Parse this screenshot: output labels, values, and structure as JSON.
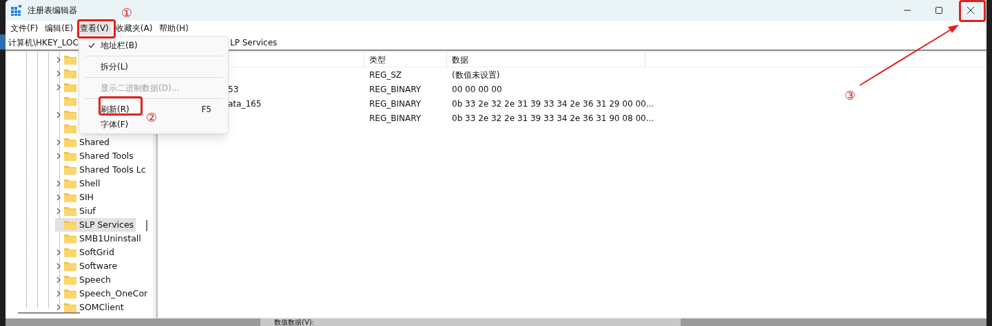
{
  "window": {
    "title": "注册表编辑器"
  },
  "window_controls": [
    {
      "kind": "minimize"
    },
    {
      "kind": "maximize"
    },
    {
      "kind": "close"
    }
  ],
  "menu_bar": [
    {
      "label": "文件(F)",
      "selected": false
    },
    {
      "label": "编辑(E)",
      "selected": false
    },
    {
      "label": "查看(V)",
      "selected": true
    },
    {
      "label": "收藏夹(A)",
      "selected": false
    },
    {
      "label": "帮助(H)",
      "selected": false
    }
  ],
  "address_bar": {
    "left": "计算机\\HKEY_LOC",
    "right": "LP Services"
  },
  "view_menu": {
    "items": [
      {
        "kind": "item",
        "label": "地址栏(B)",
        "checked": true,
        "disabled": false
      },
      {
        "kind": "separator"
      },
      {
        "kind": "item",
        "label": "拆分(L)",
        "checked": false,
        "disabled": false
      },
      {
        "kind": "separator"
      },
      {
        "kind": "item",
        "label": "显示二进制数据(D)...",
        "checked": false,
        "disabled": true
      },
      {
        "kind": "separator"
      },
      {
        "kind": "item",
        "label": "刷新(R)",
        "shortcut": "F5",
        "checked": false,
        "disabled": false
      },
      {
        "kind": "item",
        "label": "字体(F)",
        "checked": false,
        "disabled": false
      }
    ]
  },
  "tree": {
    "items": [
      {
        "expandable": true,
        "selected": false
      },
      {
        "expandable": true,
        "selected": false
      },
      {
        "expandable": true,
        "selected": false
      },
      {
        "expandable": false,
        "selected": false
      },
      {
        "expandable": true,
        "selected": false
      },
      {
        "expandable": false,
        "selected": false
      },
      {
        "label": "Shared",
        "expandable": true,
        "selected": false
      },
      {
        "label": "Shared Tools",
        "expandable": true,
        "selected": false
      },
      {
        "label": "Shared Tools Lc",
        "expandable": false,
        "selected": false
      },
      {
        "label": "Shell",
        "expandable": true,
        "selected": false
      },
      {
        "label": "SIH",
        "expandable": true,
        "selected": false
      },
      {
        "label": "Siuf",
        "expandable": true,
        "selected": false
      },
      {
        "label": "SLP Services",
        "expandable": false,
        "selected": true
      },
      {
        "label": "SMB1Uninstall",
        "expandable": false,
        "selected": false
      },
      {
        "label": "SoftGrid",
        "expandable": true,
        "selected": false
      },
      {
        "label": "Software",
        "expandable": true,
        "selected": false
      },
      {
        "label": "Speech",
        "expandable": true,
        "selected": false
      },
      {
        "label": "Speech_OneCor",
        "expandable": true,
        "selected": false
      },
      {
        "label": "SOMClient",
        "expandable": true,
        "selected": false
      }
    ]
  },
  "values_table": {
    "columns": [
      "类型",
      "数据"
    ],
    "rows": [
      {
        "type": "REG_SZ",
        "data": "(数值未设置)"
      },
      {
        "name": "53",
        "type": "REG_BINARY",
        "data": "00 00 00 00"
      },
      {
        "name": "ata_165",
        "type": "REG_BINARY",
        "data": "0b 33 2e 32 2e 31 39 33 34 2e 36 31 29 00 00..."
      },
      {
        "type": "REG_BINARY",
        "data": "0b 33 2e 32 2e 31 39 33 34 2e 36 31 90 08 00..."
      }
    ]
  },
  "annotations": {
    "marks": [
      "①",
      "②",
      "③"
    ]
  },
  "background_dialog": {
    "label": "数值数据(V):"
  }
}
